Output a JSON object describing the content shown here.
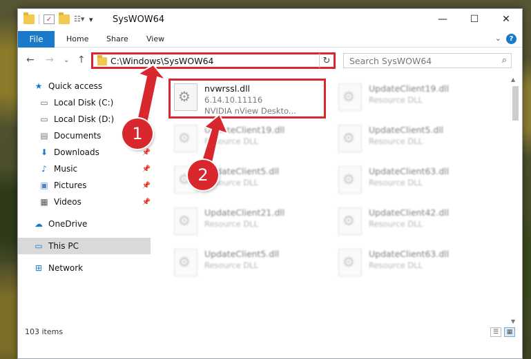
{
  "window": {
    "title": "SysWOW64"
  },
  "ribbon": {
    "file_tab": "File",
    "tabs": [
      "Home",
      "Share",
      "View"
    ],
    "help": "?"
  },
  "address": {
    "path": "C:\\Windows\\SysWOW64",
    "search_placeholder": "Search SysWOW64"
  },
  "nav_pane": {
    "items": [
      {
        "label": "Quick access",
        "icon": "star-icon",
        "pinned": false
      },
      {
        "label": "Local Disk (C:)",
        "icon": "drive-icon",
        "pinned": true
      },
      {
        "label": "Local Disk (D:)",
        "icon": "drive-icon",
        "pinned": true
      },
      {
        "label": "Documents",
        "icon": "document-icon",
        "pinned": true
      },
      {
        "label": "Downloads",
        "icon": "download-icon",
        "pinned": true
      },
      {
        "label": "Music",
        "icon": "music-icon",
        "pinned": true
      },
      {
        "label": "Pictures",
        "icon": "picture-icon",
        "pinned": true
      },
      {
        "label": "Videos",
        "icon": "video-icon",
        "pinned": true
      },
      {
        "label": "OneDrive",
        "icon": "cloud-icon",
        "pinned": false
      },
      {
        "label": "This PC",
        "icon": "computer-icon",
        "pinned": false,
        "selected": true
      },
      {
        "label": "Network",
        "icon": "network-icon",
        "pinned": false
      }
    ]
  },
  "files": [
    {
      "name": "nvwrssl.dll",
      "line2": "6.14.10.11116",
      "line3": "NVIDIA nView Deskto...",
      "highlighted": true
    },
    {
      "name": "UpdateClient19.dll",
      "line2": "Resource DLL"
    },
    {
      "name": "UpdateClient19.dll",
      "line2": "Resource DLL"
    },
    {
      "name": "UpdateClient5.dll",
      "line2": "Resource DLL"
    },
    {
      "name": "UpdateClient5.dll",
      "line2": "Resource DLL"
    },
    {
      "name": "UpdateClient63.dll",
      "line2": "Resource DLL"
    },
    {
      "name": "UpdateClient21.dll",
      "line2": "Resource DLL"
    },
    {
      "name": "UpdateClient42.dll",
      "line2": "Resource DLL"
    },
    {
      "name": "UpdateClient5.dll",
      "line2": "Resource DLL"
    },
    {
      "name": "UpdateClient63.dll",
      "line2": "Resource DLL"
    }
  ],
  "status": {
    "item_count": "103 items"
  },
  "callouts": [
    "1",
    "2"
  ],
  "colors": {
    "accent": "#1979ca",
    "annotation_red": "#d9272e"
  }
}
